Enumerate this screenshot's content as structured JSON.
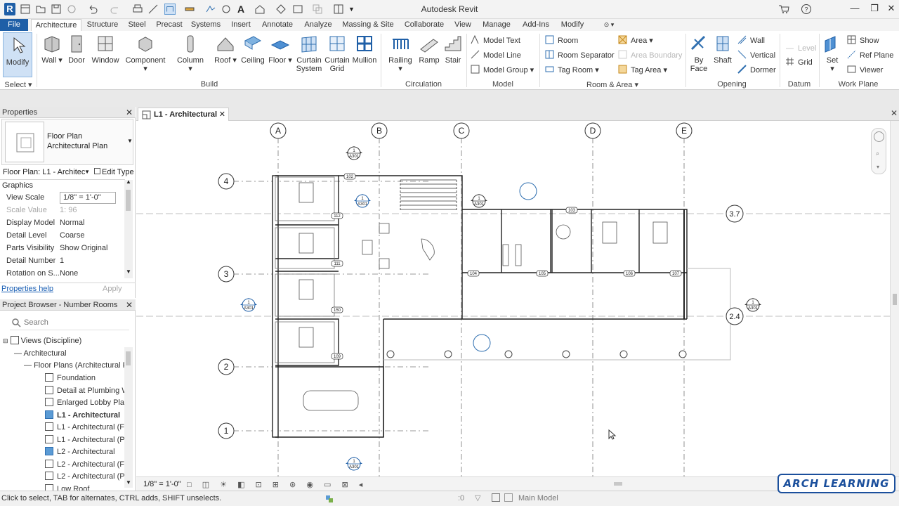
{
  "app": {
    "title": "Autodesk Revit",
    "logo_letter": "R"
  },
  "tabs": [
    "File",
    "Architecture",
    "Structure",
    "Steel",
    "Precast",
    "Systems",
    "Insert",
    "Annotate",
    "Analyze",
    "Massing & Site",
    "Collaborate",
    "View",
    "Manage",
    "Add-Ins",
    "Modify"
  ],
  "active_tab": "Architecture",
  "ribbon": {
    "select": {
      "modify": "Modify",
      "panel": "Select"
    },
    "build": {
      "wall": "Wall",
      "door": "Door",
      "window": "Window",
      "component": "Component",
      "column": "Column",
      "roof": "Roof",
      "ceiling": "Ceiling",
      "floor": "Floor",
      "curtain_system_1": "Curtain",
      "curtain_system_2": "System",
      "curtain_grid_1": "Curtain",
      "curtain_grid_2": "Grid",
      "mullion": "Mullion",
      "panel": "Build"
    },
    "circulation": {
      "railing": "Railing",
      "ramp": "Ramp",
      "stair": "Stair",
      "panel": "Circulation"
    },
    "model": {
      "text": "Model  Text",
      "line": "Model  Line",
      "group": "Model  Group",
      "panel": "Model"
    },
    "room_area": {
      "room": "Room",
      "separator": "Room  Separator",
      "tag_room": "Tag  Room",
      "area": "Area",
      "area_boundary": "Area  Boundary",
      "tag_area": "Tag  Area",
      "panel": "Room & Area"
    },
    "opening": {
      "by_face_1": "By",
      "by_face_2": "Face",
      "shaft": "Shaft",
      "wall": "Wall",
      "vertical": "Vertical",
      "dormer": "Dormer",
      "panel": "Opening"
    },
    "datum": {
      "level": "Level",
      "grid": "Grid",
      "panel": "Datum"
    },
    "work_plane": {
      "set": "Set",
      "show": "Show",
      "ref_plane": "Ref  Plane",
      "viewer": "Viewer",
      "panel": "Work Plane"
    }
  },
  "properties": {
    "header": "Properties",
    "type_name_1": "Floor Plan",
    "type_name_2": "Architectural Plan",
    "instance": "Floor Plan: L1 - Architec",
    "edit_type": "Edit Type",
    "section": "Graphics",
    "rows": [
      {
        "k": "View Scale",
        "v": "1/8\" = 1'-0\"",
        "dim": false
      },
      {
        "k": "Scale Value",
        "v": "1:  96",
        "dim": true
      },
      {
        "k": "Display Model",
        "v": "Normal",
        "dim": false
      },
      {
        "k": "Detail Level",
        "v": "Coarse",
        "dim": false
      },
      {
        "k": "Parts Visibility",
        "v": "Show Original",
        "dim": false
      },
      {
        "k": "Detail Number",
        "v": "1",
        "dim": false
      },
      {
        "k": "Rotation on S...",
        "v": "None",
        "dim": false
      }
    ],
    "help": "Properties help",
    "apply": "Apply"
  },
  "browser": {
    "header": "Project Browser - Number Rooms",
    "search_placeholder": "Search",
    "views": "Views (Discipline)",
    "architectural": "Architectural",
    "floor_plans": "Floor Plans (Architectural Pl",
    "items": [
      {
        "label": "Foundation",
        "blue": false,
        "bold": false
      },
      {
        "label": "Detail at Plumbing W",
        "blue": false,
        "bold": false
      },
      {
        "label": "Enlarged Lobby Plan",
        "blue": false,
        "bold": false
      },
      {
        "label": "L1 - Architectural",
        "blue": true,
        "bold": true
      },
      {
        "label": "L1 - Architectural (Fu",
        "blue": false,
        "bold": false
      },
      {
        "label": "L1 - Architectural (Po",
        "blue": false,
        "bold": false
      },
      {
        "label": "L2 - Architectural",
        "blue": true,
        "bold": false
      },
      {
        "label": "L2 - Architectural (Fu",
        "blue": false,
        "bold": false
      },
      {
        "label": "L2 - Architectural (Po",
        "blue": false,
        "bold": false
      },
      {
        "label": "Low Roof",
        "blue": false,
        "bold": false
      }
    ]
  },
  "view_tab": "L1 - Architectural",
  "grid": {
    "columns": [
      "A",
      "B",
      "C",
      "D",
      "E"
    ],
    "rows": [
      "4",
      "3",
      "2",
      "1"
    ],
    "levels": [
      "3.7",
      "2.4"
    ],
    "section_ref": "A301",
    "section_num": "1",
    "section_num_2": "2",
    "door_tags": [
      "102",
      "103",
      "104",
      "105",
      "106",
      "107",
      "111",
      "112",
      "150",
      "109"
    ]
  },
  "view_control": {
    "scale": "1/8\" = 1'-0\""
  },
  "status": {
    "hint": "Click to select, TAB for alternates, CTRL adds, SHIFT unselects.",
    "model": "Main Model",
    "zero": ":0"
  },
  "brand": {
    "logo": "ARCH LEARNING"
  },
  "colors": {
    "file_tab": "#1f5fa7",
    "accent": "#1b4f9c"
  }
}
